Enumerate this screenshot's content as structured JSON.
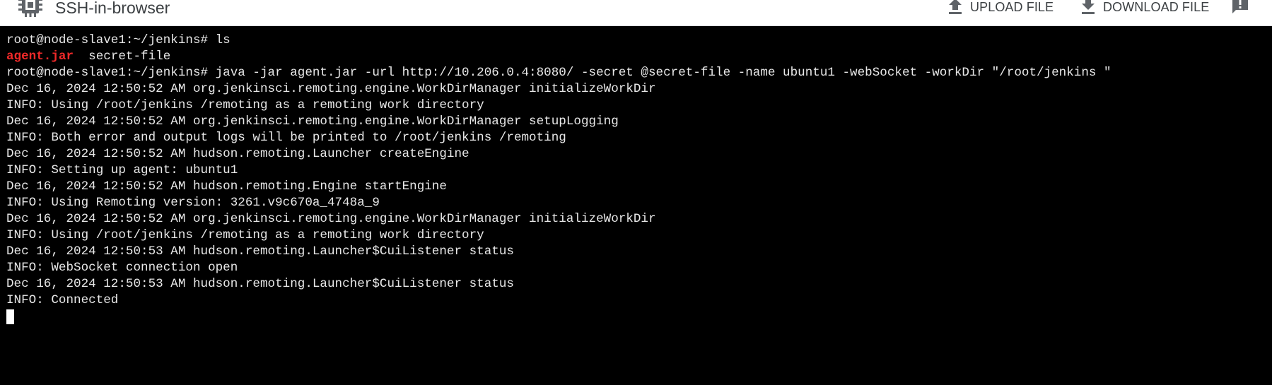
{
  "header": {
    "title": "SSH-in-browser",
    "app_icon": "chip-icon",
    "upload_label": "UPLOAD FILE",
    "upload_icon": "upload-icon",
    "download_label": "DOWNLOAD FILE",
    "download_icon": "download-icon",
    "feedback_icon": "feedback-icon"
  },
  "terminal": {
    "background": "#000000",
    "text_color": "#e8e8e8",
    "highlight_color": "#ef2929",
    "line1": "root@node-slave1:~/jenkins# ls",
    "line2_file_1": "agent.jar",
    "line2_file_2": "  secret-file",
    "line3": "root@node-slave1:~/jenkins# java -jar agent.jar -url http://10.206.0.4:8080/ -secret @secret-file -name ubuntu1 -webSocket -workDir \"/root/jenkins \"",
    "line4": "Dec 16, 2024 12:50:52 AM org.jenkinsci.remoting.engine.WorkDirManager initializeWorkDir",
    "line5": "INFO: Using /root/jenkins /remoting as a remoting work directory",
    "line6": "Dec 16, 2024 12:50:52 AM org.jenkinsci.remoting.engine.WorkDirManager setupLogging",
    "line7": "INFO: Both error and output logs will be printed to /root/jenkins /remoting",
    "line8": "Dec 16, 2024 12:50:52 AM hudson.remoting.Launcher createEngine",
    "line9": "INFO: Setting up agent: ubuntu1",
    "line10": "Dec 16, 2024 12:50:52 AM hudson.remoting.Engine startEngine",
    "line11": "INFO: Using Remoting version: 3261.v9c670a_4748a_9",
    "line12": "Dec 16, 2024 12:50:52 AM org.jenkinsci.remoting.engine.WorkDirManager initializeWorkDir",
    "line13": "INFO: Using /root/jenkins /remoting as a remoting work directory",
    "line14": "Dec 16, 2024 12:50:53 AM hudson.remoting.Launcher$CuiListener status",
    "line15": "INFO: WebSocket connection open",
    "line16": "Dec 16, 2024 12:50:53 AM hudson.remoting.Launcher$CuiListener status",
    "line17": "INFO: Connected"
  }
}
